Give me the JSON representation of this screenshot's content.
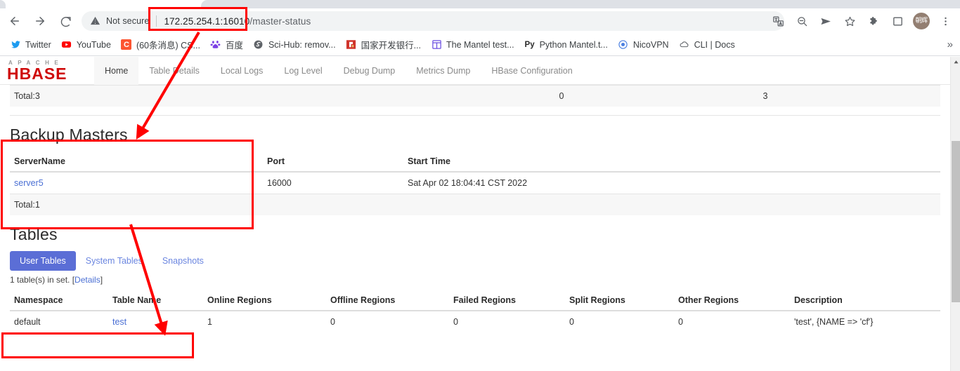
{
  "browser": {
    "nav": {
      "back": "Back",
      "forward": "Forward",
      "reload": "Reload"
    },
    "omnibox": {
      "security_label": "Not secure",
      "url_host": "172.25.254.1:16010",
      "url_path": "/master-status"
    },
    "toolbar_icons": [
      "translate-icon",
      "zoom-out-icon",
      "send-icon",
      "bookmark-star-icon",
      "extensions-puzzle-icon",
      "side-panel-icon"
    ],
    "avatar_label": "朝辉",
    "menu_icon": "more-vertical-icon",
    "bookmarks": [
      {
        "label": "Twitter",
        "icon": "twitter-icon",
        "color": "#1d9bf0"
      },
      {
        "label": "YouTube",
        "icon": "youtube-icon",
        "color": "#ff0000"
      },
      {
        "label": "(60条消息) CS...",
        "icon": "csdn-icon",
        "color": "#fc5531",
        "glyph": "C"
      },
      {
        "label": "百度",
        "icon": "baidu-icon",
        "color": "#7b3fe4"
      },
      {
        "label": "Sci-Hub: remov...",
        "icon": "scihub-globe-icon",
        "color": "#5f6368"
      },
      {
        "label": "国家开发银行...",
        "icon": "cdb-bank-icon",
        "color": "#d0342c"
      },
      {
        "label": "The Mantel test...",
        "icon": "notion-window-icon",
        "color": "#6b4fe0"
      },
      {
        "label": "Python Mantel.t...",
        "icon": "python-icon",
        "color": "#2b2b2b",
        "glyph": "Py"
      },
      {
        "label": "NicoVPN",
        "icon": "nicovpn-icon",
        "color": "#4a7fe0"
      },
      {
        "label": "CLI | Docs",
        "icon": "cloud-icon",
        "color": "#5f6368"
      }
    ],
    "overflow_label": "»"
  },
  "hbase": {
    "brand": {
      "top": "APACHE",
      "main": "HBASE"
    },
    "nav_links": [
      {
        "label": "Home",
        "active": true
      },
      {
        "label": "Table Details",
        "active": false
      },
      {
        "label": "Local Logs",
        "active": false
      },
      {
        "label": "Log Level",
        "active": false
      },
      {
        "label": "Debug Dump",
        "active": false
      },
      {
        "label": "Metrics Dump",
        "active": false
      },
      {
        "label": "HBase Configuration",
        "active": false
      }
    ],
    "region_servers_total": {
      "label": "Total:3",
      "col_b": "0",
      "col_c": "3"
    },
    "backup_masters": {
      "title": "Backup Masters",
      "headers": [
        "ServerName",
        "Port",
        "Start Time"
      ],
      "rows": [
        {
          "server_name": "server5",
          "port": "16000",
          "start_time": "Sat Apr 02 18:04:41 CST 2022"
        }
      ],
      "total": "Total:1"
    },
    "tables": {
      "title": "Tables",
      "tabs": [
        {
          "label": "User Tables",
          "active": true
        },
        {
          "label": "System Tables",
          "active": false
        },
        {
          "label": "Snapshots",
          "active": false
        }
      ],
      "set_info_prefix": "1 table(s) in set. [",
      "set_info_link": "Details",
      "set_info_suffix": "]",
      "headers": [
        "Namespace",
        "Table Name",
        "Online Regions",
        "Offline Regions",
        "Failed Regions",
        "Split Regions",
        "Other Regions",
        "Description"
      ],
      "rows": [
        {
          "namespace": "default",
          "table_name": "test",
          "online_regions": "1",
          "offline_regions": "0",
          "failed_regions": "0",
          "split_regions": "0",
          "other_regions": "0",
          "description": "'test', {NAME => 'cf'}"
        }
      ]
    }
  },
  "annotations": {
    "color": "#ff0000",
    "boxes": [
      {
        "name": "url-highlight-box"
      },
      {
        "name": "backup-masters-highlight-box"
      },
      {
        "name": "table-row-highlight-box"
      }
    ],
    "arrows": [
      {
        "name": "arrow-url-to-backup-masters"
      },
      {
        "name": "arrow-backup-masters-to-table-row"
      }
    ]
  }
}
